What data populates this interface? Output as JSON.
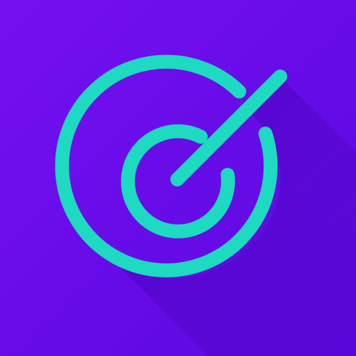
{
  "icon": {
    "semantic": "target-icon",
    "colors": {
      "background_top": "#7510f0",
      "background_bottom": "#5a08e0",
      "shadow": "#5205c9",
      "stroke": "#1ddac0"
    }
  }
}
